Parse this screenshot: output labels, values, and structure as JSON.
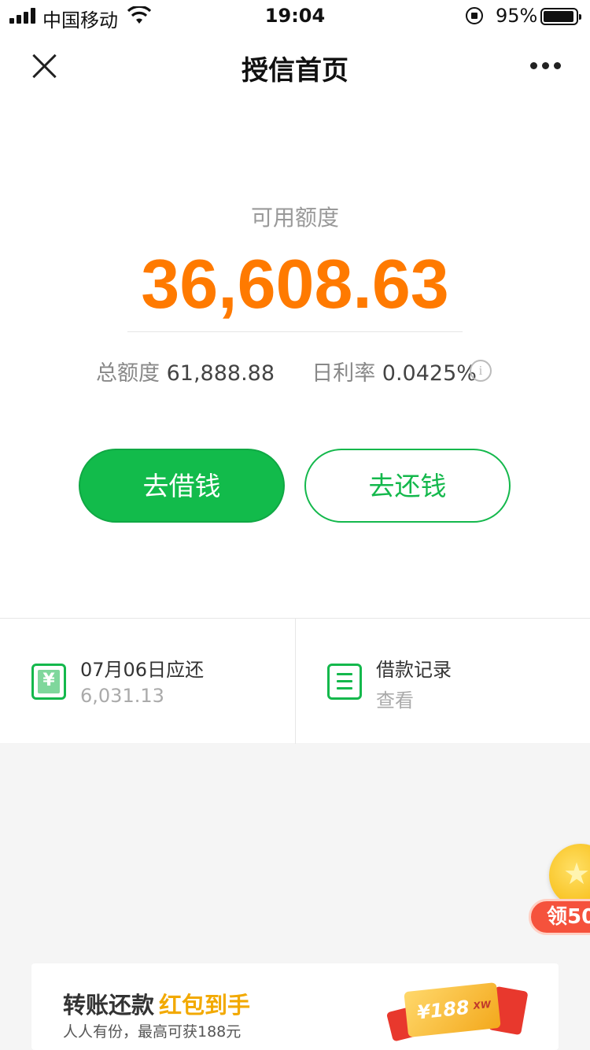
{
  "status_bar": {
    "carrier": "中国移动",
    "time": "19:04",
    "battery_percent": "95%",
    "battery_level": 0.95
  },
  "nav": {
    "title": "授信首页",
    "close_icon": "close-icon",
    "more_icon": "more-dots-icon"
  },
  "quota": {
    "label": "可用额度",
    "amount": "36,608.63",
    "total_label": "总额度",
    "total_value": "61,888.88",
    "rate_label": "日利率",
    "rate_value": "0.0425%",
    "info_glyph": "i"
  },
  "actions": {
    "borrow_label": "去借钱",
    "repay_label": "去还钱"
  },
  "cards": {
    "due": {
      "title": "07月06日应还",
      "amount": "6,031.13",
      "icon": "yen-bill-icon",
      "icon_glyph": "¥"
    },
    "records": {
      "title": "借款记录",
      "sub": "查看",
      "icon": "list-icon"
    }
  },
  "floating": {
    "badge_label": "领50",
    "icon": "gold-coin-icon"
  },
  "banner": {
    "title_part1": "转账还款",
    "title_part2": "红包到手",
    "subtitle": "人人有份，最高可获188元",
    "coupon_text": "¥188",
    "coupon_tag": "XW"
  },
  "colors": {
    "accent_green": "#12bb4b",
    "amount_orange": "#ff7a00",
    "banner_gold": "#f2a900",
    "badge_red": "#f5523c"
  }
}
